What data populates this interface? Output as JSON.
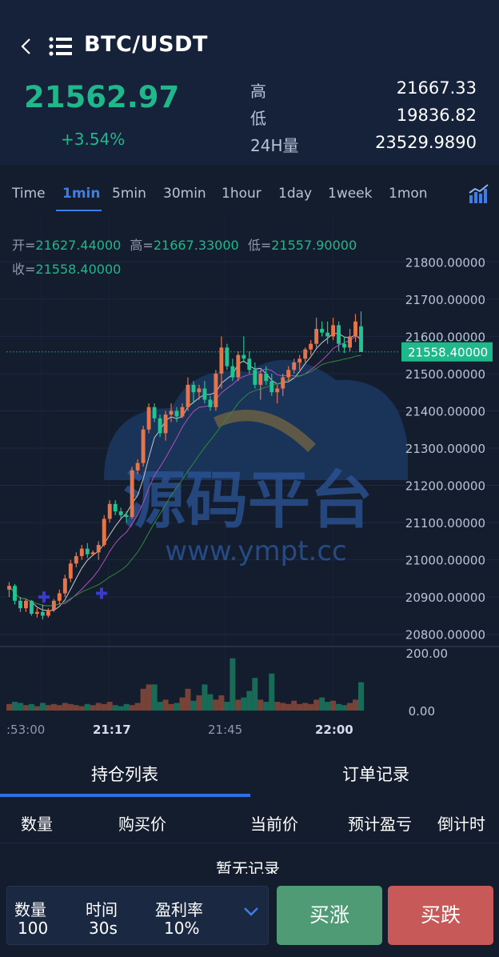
{
  "header": {
    "pair": "BTC/USDT",
    "last_price": "21562.97",
    "change": "+3.54%",
    "stats": [
      {
        "label": "高",
        "value": "21667.33"
      },
      {
        "label": "低",
        "value": "19836.82"
      },
      {
        "label": "24H量",
        "value": "23529.9890"
      }
    ]
  },
  "tabs": [
    "Time",
    "1min",
    "5min",
    "30min",
    "1hour",
    "1day",
    "1week",
    "1mon"
  ],
  "active_tab": "1min",
  "ohlc": {
    "open_label": "开=",
    "open": "21627.44000",
    "high_label": "高=",
    "high": "21667.33000",
    "low_label": "低=",
    "low": "21557.90000",
    "close_label": "收=",
    "close": "21558.40000"
  },
  "chart_data": {
    "type": "candlestick",
    "y_ticks": [
      "21800.00000",
      "21700.00000",
      "21600.00000",
      "21500.00000",
      "21400.00000",
      "21300.00000",
      "21200.00000",
      "21100.00000",
      "21000.00000",
      "20900.00000",
      "20800.00000"
    ],
    "current_price_label": "21558.40000",
    "volume_ticks": [
      "200.00",
      "0.00"
    ],
    "x_ticks": [
      ":53:00",
      "21:17",
      "21:45",
      "22:00"
    ],
    "ylim": [
      20780,
      21820
    ],
    "candles": [
      [
        20920,
        20940,
        20900,
        20930
      ],
      [
        20930,
        20935,
        20880,
        20890
      ],
      [
        20890,
        20900,
        20860,
        20870
      ],
      [
        20870,
        20895,
        20860,
        20890
      ],
      [
        20890,
        20892,
        20850,
        20855
      ],
      [
        20855,
        20870,
        20845,
        20860
      ],
      [
        20860,
        20880,
        20840,
        20850
      ],
      [
        20850,
        20870,
        20845,
        20865
      ],
      [
        20865,
        20895,
        20860,
        20890
      ],
      [
        20890,
        20920,
        20880,
        20910
      ],
      [
        20910,
        20960,
        20900,
        20950
      ],
      [
        20950,
        21000,
        20940,
        20990
      ],
      [
        20990,
        21020,
        20980,
        21010
      ],
      [
        21010,
        21040,
        21000,
        21030
      ],
      [
        21030,
        21045,
        21005,
        21015
      ],
      [
        21015,
        21025,
        21010,
        21020
      ],
      [
        21020,
        21050,
        21000,
        21040
      ],
      [
        21040,
        21120,
        21035,
        21110
      ],
      [
        21110,
        21160,
        21100,
        21150
      ],
      [
        21150,
        21160,
        21120,
        21130
      ],
      [
        21130,
        21140,
        21110,
        21120
      ],
      [
        21120,
        21130,
        21100,
        21115
      ],
      [
        21115,
        21250,
        21110,
        21240
      ],
      [
        21240,
        21270,
        21230,
        21260
      ],
      [
        21260,
        21360,
        21250,
        21350
      ],
      [
        21350,
        21420,
        21340,
        21410
      ],
      [
        21410,
        21420,
        21370,
        21380
      ],
      [
        21380,
        21390,
        21330,
        21340
      ],
      [
        21340,
        21400,
        21320,
        21390
      ],
      [
        21390,
        21420,
        21370,
        21400
      ],
      [
        21400,
        21410,
        21370,
        21385
      ],
      [
        21385,
        21420,
        21380,
        21410
      ],
      [
        21410,
        21490,
        21400,
        21470
      ],
      [
        21470,
        21480,
        21420,
        21450
      ],
      [
        21450,
        21470,
        21430,
        21460
      ],
      [
        21460,
        21480,
        21420,
        21430
      ],
      [
        21430,
        21440,
        21400,
        21410
      ],
      [
        21410,
        21510,
        21400,
        21500
      ],
      [
        21500,
        21600,
        21460,
        21570
      ],
      [
        21570,
        21580,
        21510,
        21520
      ],
      [
        21520,
        21540,
        21480,
        21490
      ],
      [
        21490,
        21560,
        21480,
        21550
      ],
      [
        21550,
        21600,
        21530,
        21540
      ],
      [
        21540,
        21560,
        21500,
        21510
      ],
      [
        21510,
        21530,
        21460,
        21470
      ],
      [
        21470,
        21510,
        21430,
        21500
      ],
      [
        21500,
        21520,
        21470,
        21480
      ],
      [
        21480,
        21500,
        21440,
        21450
      ],
      [
        21450,
        21470,
        21420,
        21460
      ],
      [
        21460,
        21500,
        21440,
        21490
      ],
      [
        21490,
        21520,
        21480,
        21510
      ],
      [
        21510,
        21540,
        21500,
        21530
      ],
      [
        21530,
        21550,
        21510,
        21540
      ],
      [
        21540,
        21570,
        21530,
        21565
      ],
      [
        21565,
        21590,
        21550,
        21580
      ],
      [
        21580,
        21650,
        21570,
        21620
      ],
      [
        21620,
        21640,
        21600,
        21610
      ],
      [
        21610,
        21640,
        21580,
        21600
      ],
      [
        21600,
        21650,
        21590,
        21630
      ],
      [
        21630,
        21640,
        21560,
        21580
      ],
      [
        21580,
        21600,
        21555,
        21570
      ],
      [
        21570,
        21620,
        21560,
        21600
      ],
      [
        21600,
        21660,
        21585,
        21640
      ],
      [
        21627,
        21667,
        21558,
        21558
      ]
    ],
    "volumes": [
      6,
      8,
      7,
      5,
      6,
      4,
      7,
      5,
      6,
      5,
      7,
      6,
      5,
      4,
      6,
      5,
      7,
      6,
      8,
      5,
      4,
      6,
      5,
      7,
      20,
      24,
      24,
      8,
      10,
      6,
      7,
      12,
      20,
      9,
      14,
      24,
      15,
      10,
      14,
      8,
      48,
      10,
      12,
      18,
      30,
      10,
      8,
      34,
      8,
      7,
      6,
      9,
      6,
      7,
      6,
      10,
      12,
      8,
      9,
      6,
      5,
      7,
      10,
      26
    ]
  },
  "watermark": {
    "cn": "源码平台",
    "url": "www.ympt.cc"
  },
  "positions": {
    "tabs": [
      "持仓列表",
      "订单记录"
    ],
    "columns": [
      "数量",
      "购买价",
      "当前价",
      "预计盈亏",
      "倒计时"
    ],
    "empty_text": "暂无记录"
  },
  "order": {
    "qty_label": "数量",
    "qty": "100",
    "time_label": "时间",
    "time": "30s",
    "rate_label": "盈利率",
    "rate": "10%",
    "buy_up": "买涨",
    "buy_down": "买跌"
  },
  "colors": {
    "up": "#e8744a",
    "down": "#1fc490",
    "accent": "#3d7eeb"
  }
}
